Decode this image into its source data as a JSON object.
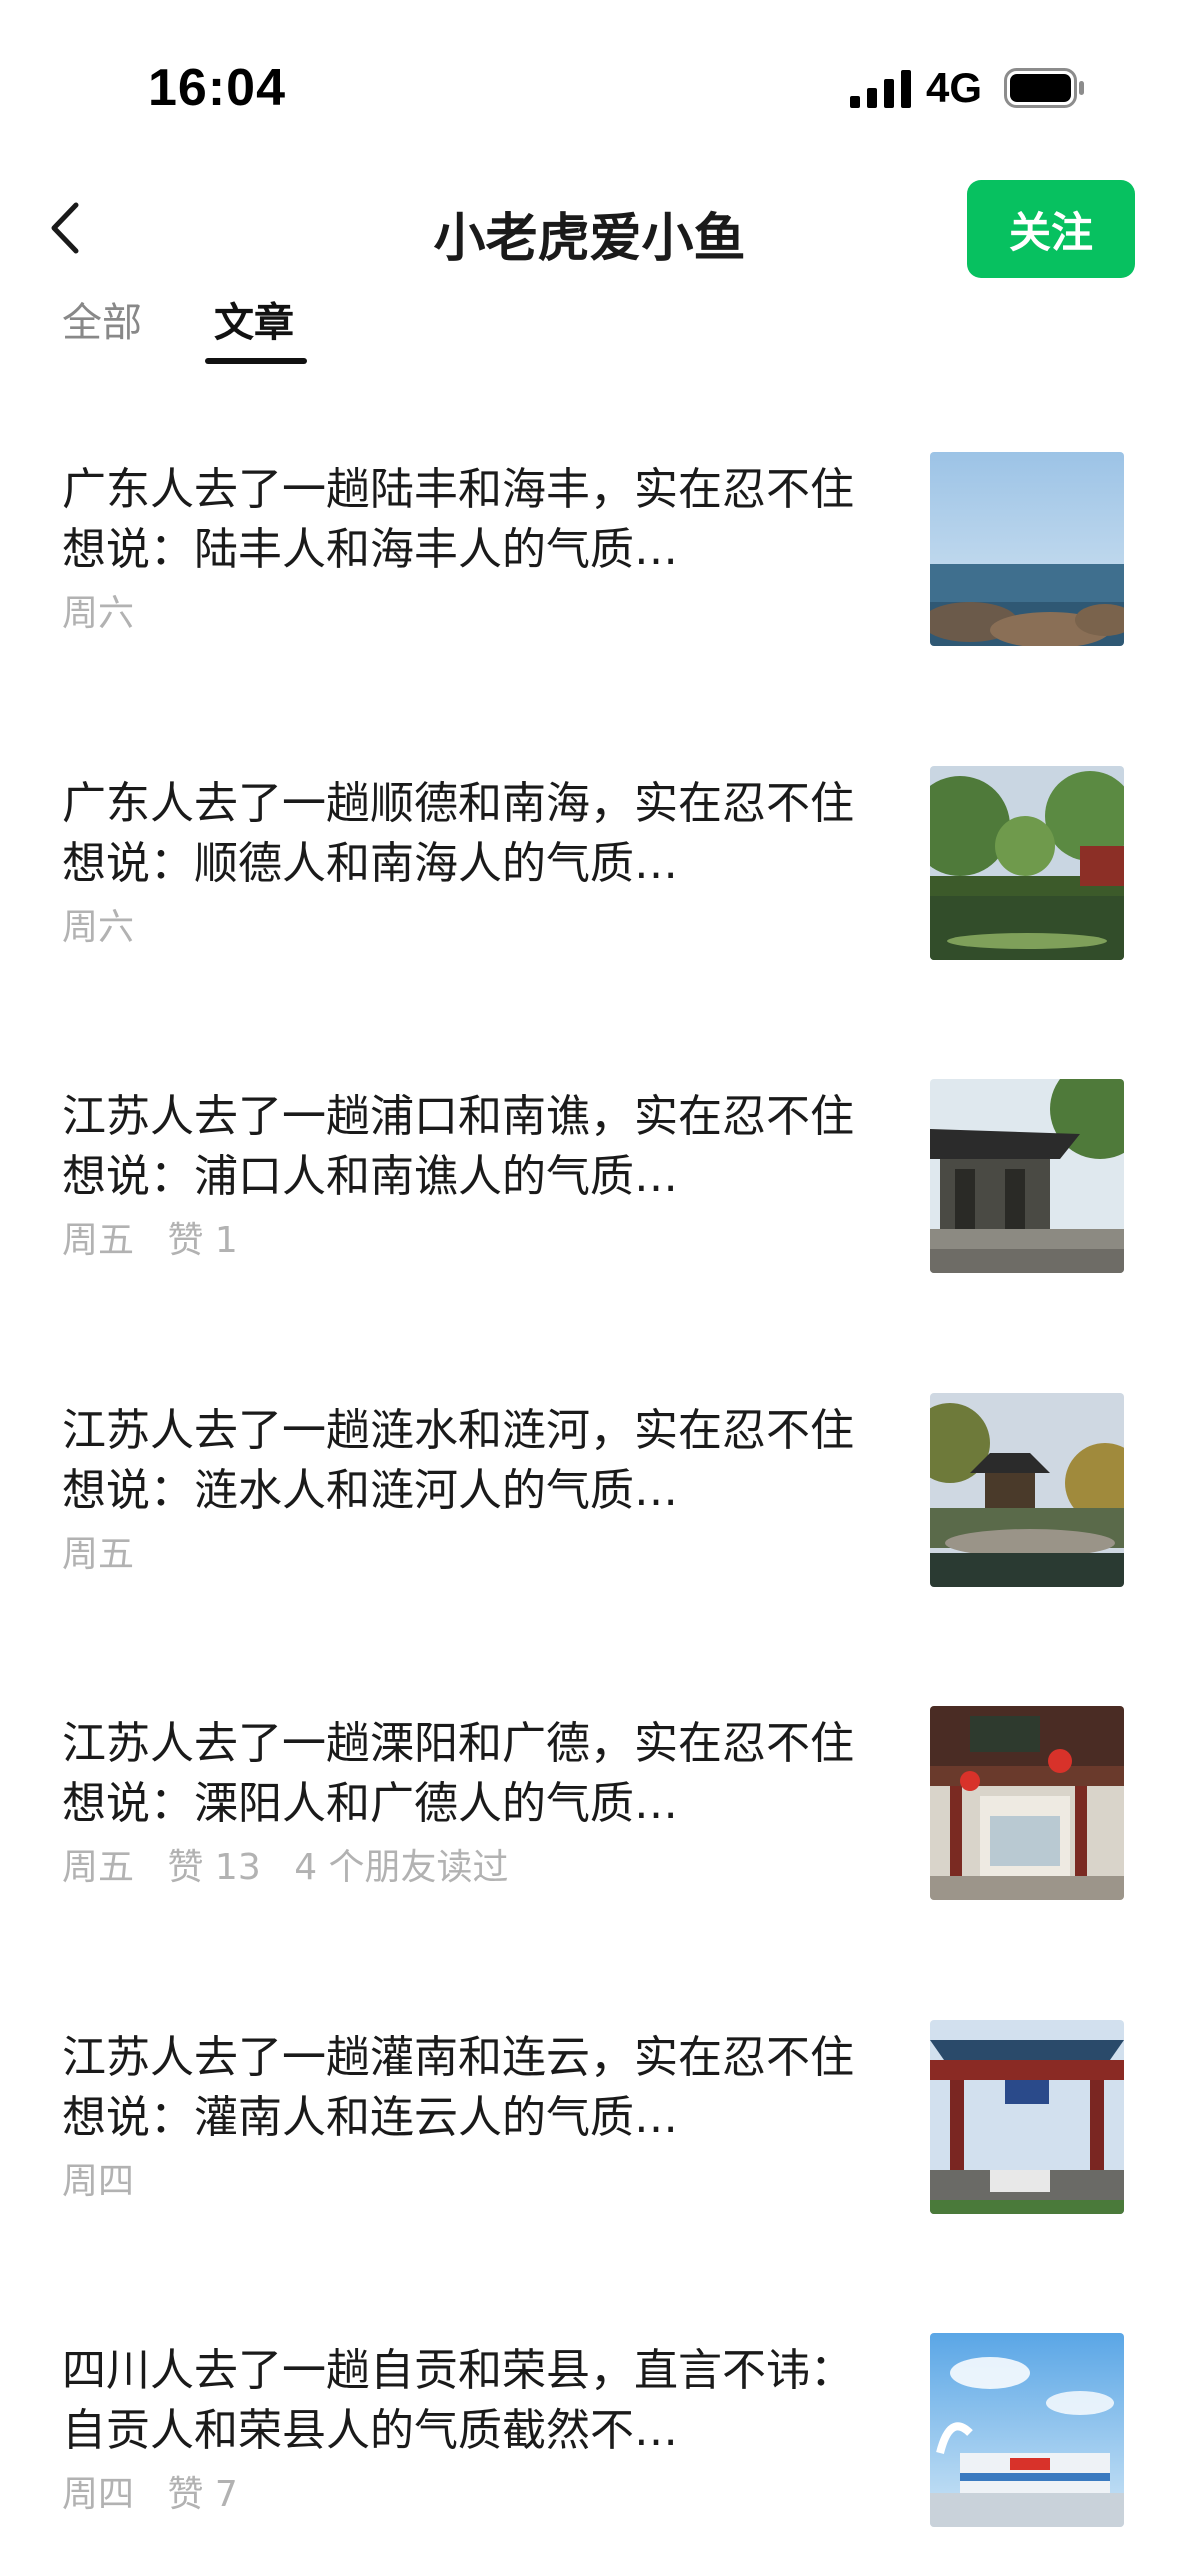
{
  "status_bar": {
    "time": "16:04",
    "network": "4G"
  },
  "header": {
    "title": "小老虎爱小鱼",
    "follow_label": "关注"
  },
  "tabs": [
    {
      "label": "全部"
    },
    {
      "label": "文章"
    }
  ],
  "articles": [
    {
      "title": "广东人去了一趟陆丰和海丰，实在忍不住想说：陆丰人和海丰人的气质…",
      "date": "周六",
      "likes": "",
      "friends": ""
    },
    {
      "title": "广东人去了一趟顺德和南海，实在忍不住想说：顺德人和南海人的气质…",
      "date": "周六",
      "likes": "",
      "friends": ""
    },
    {
      "title": "江苏人去了一趟浦口和南谯，实在忍不住想说：浦口人和南谯人的气质…",
      "date": "周五",
      "likes": "赞 1",
      "friends": ""
    },
    {
      "title": "江苏人去了一趟涟水和涟河，实在忍不住想说：涟水人和涟河人的气质…",
      "date": "周五",
      "likes": "",
      "friends": ""
    },
    {
      "title": "江苏人去了一趟溧阳和广德，实在忍不住想说：溧阳人和广德人的气质…",
      "date": "周五",
      "likes": "赞 13",
      "friends": "4 个朋友读过"
    },
    {
      "title": "江苏人去了一趟灌南和连云，实在忍不住想说：灌南人和连云人的气质…",
      "date": "周四",
      "likes": "",
      "friends": ""
    },
    {
      "title": "四川人去了一趟自贡和荣县，直言不讳：自贡人和荣县人的气质截然不…",
      "date": "周四",
      "likes": "赞 7",
      "friends": ""
    }
  ],
  "colors": {
    "accent": "#07c160",
    "meta_text": "#b2b2b2",
    "tab_active": "#111111",
    "tab_inactive": "#888888"
  }
}
